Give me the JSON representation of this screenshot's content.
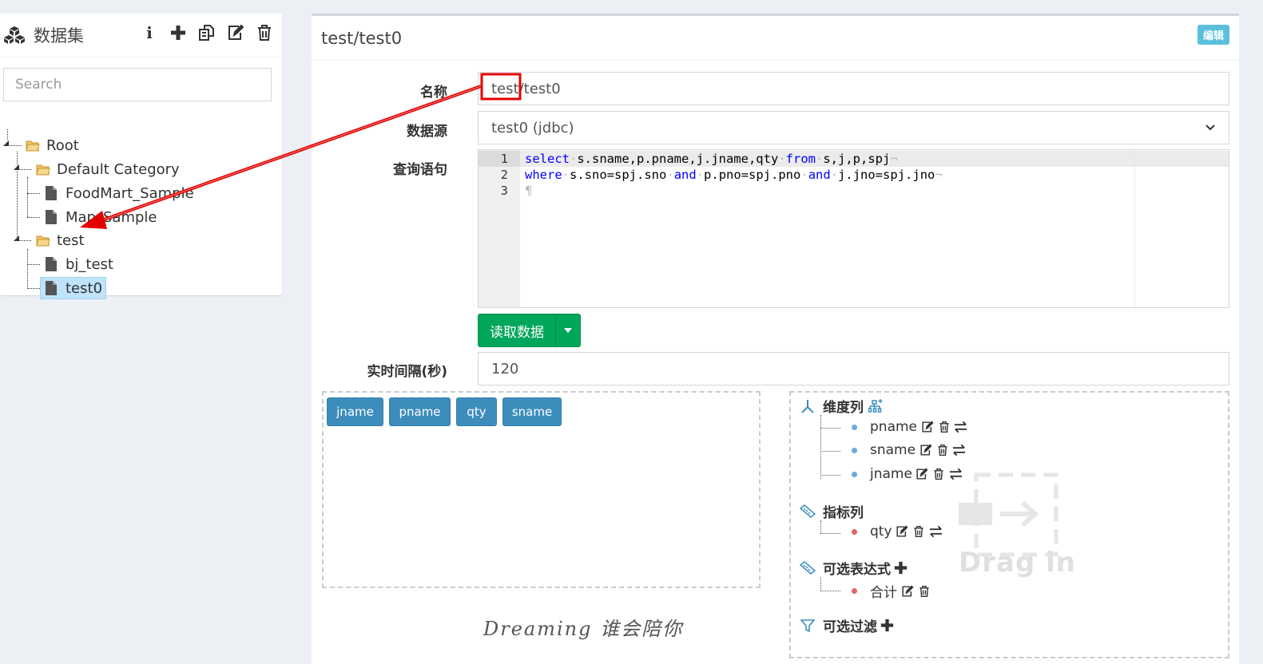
{
  "left_panel": {
    "title": "数据集",
    "tools": [
      "info-icon",
      "plus-icon",
      "copy-icon",
      "edit-icon",
      "trash-icon"
    ],
    "search_placeholder": "Search",
    "tree": {
      "root": "Root",
      "default_category": "Default Category",
      "foodmart": "FoodMart_Sample",
      "map_sample": "Map_Sample",
      "test": "test",
      "bj_test": "bj_test",
      "test0": "test0"
    }
  },
  "main": {
    "title": "test/test0",
    "edit_badge": "编辑",
    "labels": {
      "name": "名称",
      "datasource": "数据源",
      "query": "查询语句",
      "interval": "实时间隔(秒)"
    },
    "name_value": "test/test0",
    "datasource_value": "test0 (jdbc)",
    "query_lines": [
      "select s.sname,p.pname,j.jname,qty from s,j,p,spj",
      "where s.sno=spj.sno and p.pno=spj.pno and j.jno=spj.jno",
      ""
    ],
    "line_numbers": [
      "1",
      "2",
      "3"
    ],
    "read_button": "读取数据",
    "interval_value": "120",
    "fields": [
      "jname",
      "pname",
      "qty",
      "sname"
    ],
    "dimension": {
      "title": "维度列",
      "items": [
        "pname",
        "sname",
        "jname"
      ]
    },
    "measure": {
      "title": "指标列",
      "items": [
        "qty"
      ]
    },
    "expression": {
      "title": "可选表达式",
      "items": [
        "合计"
      ]
    },
    "filter": {
      "title": "可选过滤"
    },
    "drag_text": "Drag in",
    "watermark": "Dreaming 谁会陪你"
  },
  "colors": {
    "success": "#00a65a",
    "primary": "#3c8dbc",
    "info": "#5bc0de",
    "annotation": "#e30000"
  }
}
